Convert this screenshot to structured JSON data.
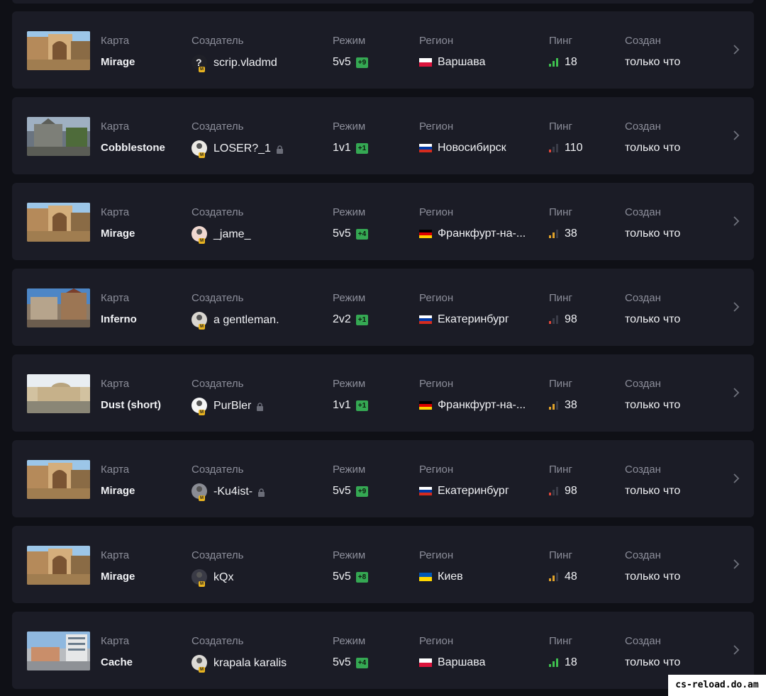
{
  "labels": {
    "map": "Карта",
    "creator": "Создатель",
    "mode": "Режим",
    "region": "Регион",
    "ping": "Пинг",
    "created": "Создан"
  },
  "colors": {
    "ping_good": "#3fbf4f",
    "ping_mid": "#e0a22a",
    "ping_bad": "#e0473a",
    "mode_badge": "#35a853"
  },
  "servers": [
    {
      "map": "Mirage",
      "thumb": "mirage",
      "creator": "scrip.vladmd",
      "avatar": "question-icon",
      "locked": false,
      "mode": "5v5",
      "slots": "+9",
      "flag": "pl",
      "region": "Варшава",
      "ping": "18",
      "ping_level": "good",
      "created": "только что"
    },
    {
      "map": "Cobblestone",
      "thumb": "cobblestone",
      "creator": "LOSER?_1",
      "avatar": "user-avatar",
      "locked": true,
      "mode": "1v1",
      "slots": "+1",
      "flag": "ru",
      "region": "Новосибирск",
      "ping": "110",
      "ping_level": "bad",
      "created": "только что"
    },
    {
      "map": "Mirage",
      "thumb": "mirage",
      "creator": "_jame_",
      "avatar": "user-avatar",
      "locked": false,
      "mode": "5v5",
      "slots": "+4",
      "flag": "de",
      "region": "Франкфурт-на-...",
      "ping": "38",
      "ping_level": "mid",
      "created": "только что"
    },
    {
      "map": "Inferno",
      "thumb": "inferno",
      "creator": "a gentleman.",
      "avatar": "user-avatar",
      "locked": false,
      "mode": "2v2",
      "slots": "+1",
      "flag": "ru",
      "region": "Екатеринбург",
      "ping": "98",
      "ping_level": "bad",
      "created": "только что"
    },
    {
      "map": "Dust (short)",
      "thumb": "dust",
      "creator": "PurBler",
      "avatar": "user-avatar",
      "locked": true,
      "mode": "1v1",
      "slots": "+1",
      "flag": "de",
      "region": "Франкфурт-на-...",
      "ping": "38",
      "ping_level": "mid",
      "created": "только что"
    },
    {
      "map": "Mirage",
      "thumb": "mirage",
      "creator": "-Ku4ist-",
      "avatar": "user-avatar",
      "locked": true,
      "mode": "5v5",
      "slots": "+9",
      "flag": "ru",
      "region": "Екатеринбург",
      "ping": "98",
      "ping_level": "bad",
      "created": "только что"
    },
    {
      "map": "Mirage",
      "thumb": "mirage",
      "creator": "kQx",
      "avatar": "user-avatar",
      "locked": false,
      "mode": "5v5",
      "slots": "+8",
      "flag": "ua",
      "region": "Киев",
      "ping": "48",
      "ping_level": "mid",
      "created": "только что"
    },
    {
      "map": "Cache",
      "thumb": "cache",
      "creator": "krapala karalis",
      "avatar": "user-avatar",
      "locked": false,
      "mode": "5v5",
      "slots": "+4",
      "flag": "pl",
      "region": "Варшава",
      "ping": "18",
      "ping_level": "good",
      "created": "только что"
    }
  ],
  "watermark": "cs-reload.do.am"
}
